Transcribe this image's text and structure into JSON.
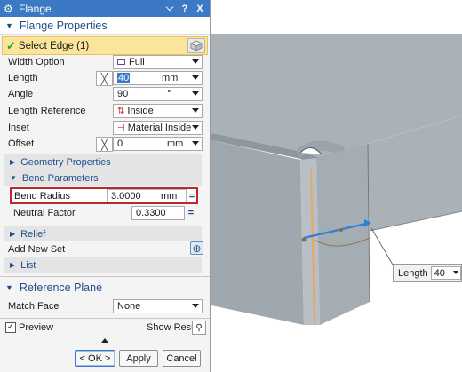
{
  "dialog": {
    "title": "Flange",
    "help_label": "?",
    "close_label": "X"
  },
  "flange_properties": {
    "header": "Flange Properties",
    "select_edge": "Select Edge (1)",
    "width_option": {
      "label": "Width Option",
      "value": "Full"
    },
    "length": {
      "label": "Length",
      "value": "40",
      "unit": "mm"
    },
    "angle": {
      "label": "Angle",
      "value": "90",
      "unit": "°"
    },
    "length_reference": {
      "label": "Length Reference",
      "value": "Inside"
    },
    "inset": {
      "label": "Inset",
      "value": "Material Inside"
    },
    "offset": {
      "label": "Offset",
      "value": "0",
      "unit": "mm"
    },
    "geometry_properties": "Geometry Properties",
    "bend_parameters": "Bend Parameters",
    "bend_radius": {
      "label": "Bend Radius",
      "value": "3.0000",
      "unit": "mm"
    },
    "neutral_factor": {
      "label": "Neutral Factor",
      "value": "0.3300"
    },
    "relief": "Relief",
    "add_new_set": "Add New Set",
    "list": "List"
  },
  "reference_plane": {
    "header": "Reference Plane",
    "match_face": {
      "label": "Match Face",
      "value": "None"
    }
  },
  "footer": {
    "preview_label": "Preview",
    "preview_checked": true,
    "show_result_label": "Show Result",
    "ok_label": "< OK >",
    "apply_label": "Apply",
    "cancel_label": "Cancel"
  },
  "viewport": {
    "length_popup": {
      "label": "Length",
      "value": "40"
    }
  },
  "colors": {
    "title_bar": "#3b79c4",
    "selection_highlight": "#fbe59b",
    "bend_radius_outline": "#c0272d",
    "model_gray": "#a9b1b7",
    "bend_edge": "#e8a860",
    "drag_handle": "#2f7fd8"
  }
}
